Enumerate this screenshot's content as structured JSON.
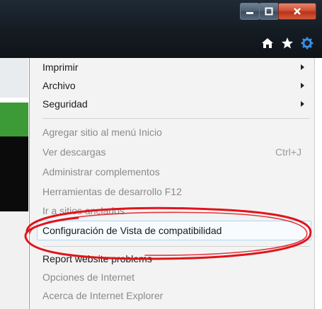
{
  "window": {
    "controls": [
      {
        "name": "minimize-button",
        "icon": "minimize-icon"
      },
      {
        "name": "maximize-button",
        "icon": "maximize-icon"
      },
      {
        "name": "close-button",
        "icon": "close-icon"
      }
    ],
    "toolbar_icons": [
      "home-icon",
      "favorites-star-icon",
      "tools-gear-icon"
    ]
  },
  "menu": {
    "items": [
      {
        "label": "Imprimir",
        "submenu": true,
        "enabled": true
      },
      {
        "label": "Archivo",
        "submenu": true,
        "enabled": true
      },
      {
        "label": "Seguridad",
        "submenu": true,
        "enabled": true
      },
      {
        "label": "Agregar sitio al menú Inicio",
        "enabled": false
      },
      {
        "label": "Ver descargas",
        "shortcut": "Ctrl+J",
        "enabled": false
      },
      {
        "label": "Administrar complementos",
        "enabled": false
      },
      {
        "label": "Herramientas de desarrollo F12",
        "enabled": false
      },
      {
        "label": "Ir a sitios anclados",
        "enabled": false
      },
      {
        "label": "Configuración de Vista de compatibilidad",
        "enabled": true,
        "highlighted": true
      },
      {
        "label": "Report website problems",
        "enabled": true
      },
      {
        "label": "Opciones de Internet",
        "enabled": false
      },
      {
        "label": "Acerca de Internet Explorer",
        "enabled": false
      }
    ]
  },
  "colors": {
    "annotation_ellipse": "#e0141b",
    "title_bar": "#141b22",
    "close_button": "#c9432a"
  }
}
